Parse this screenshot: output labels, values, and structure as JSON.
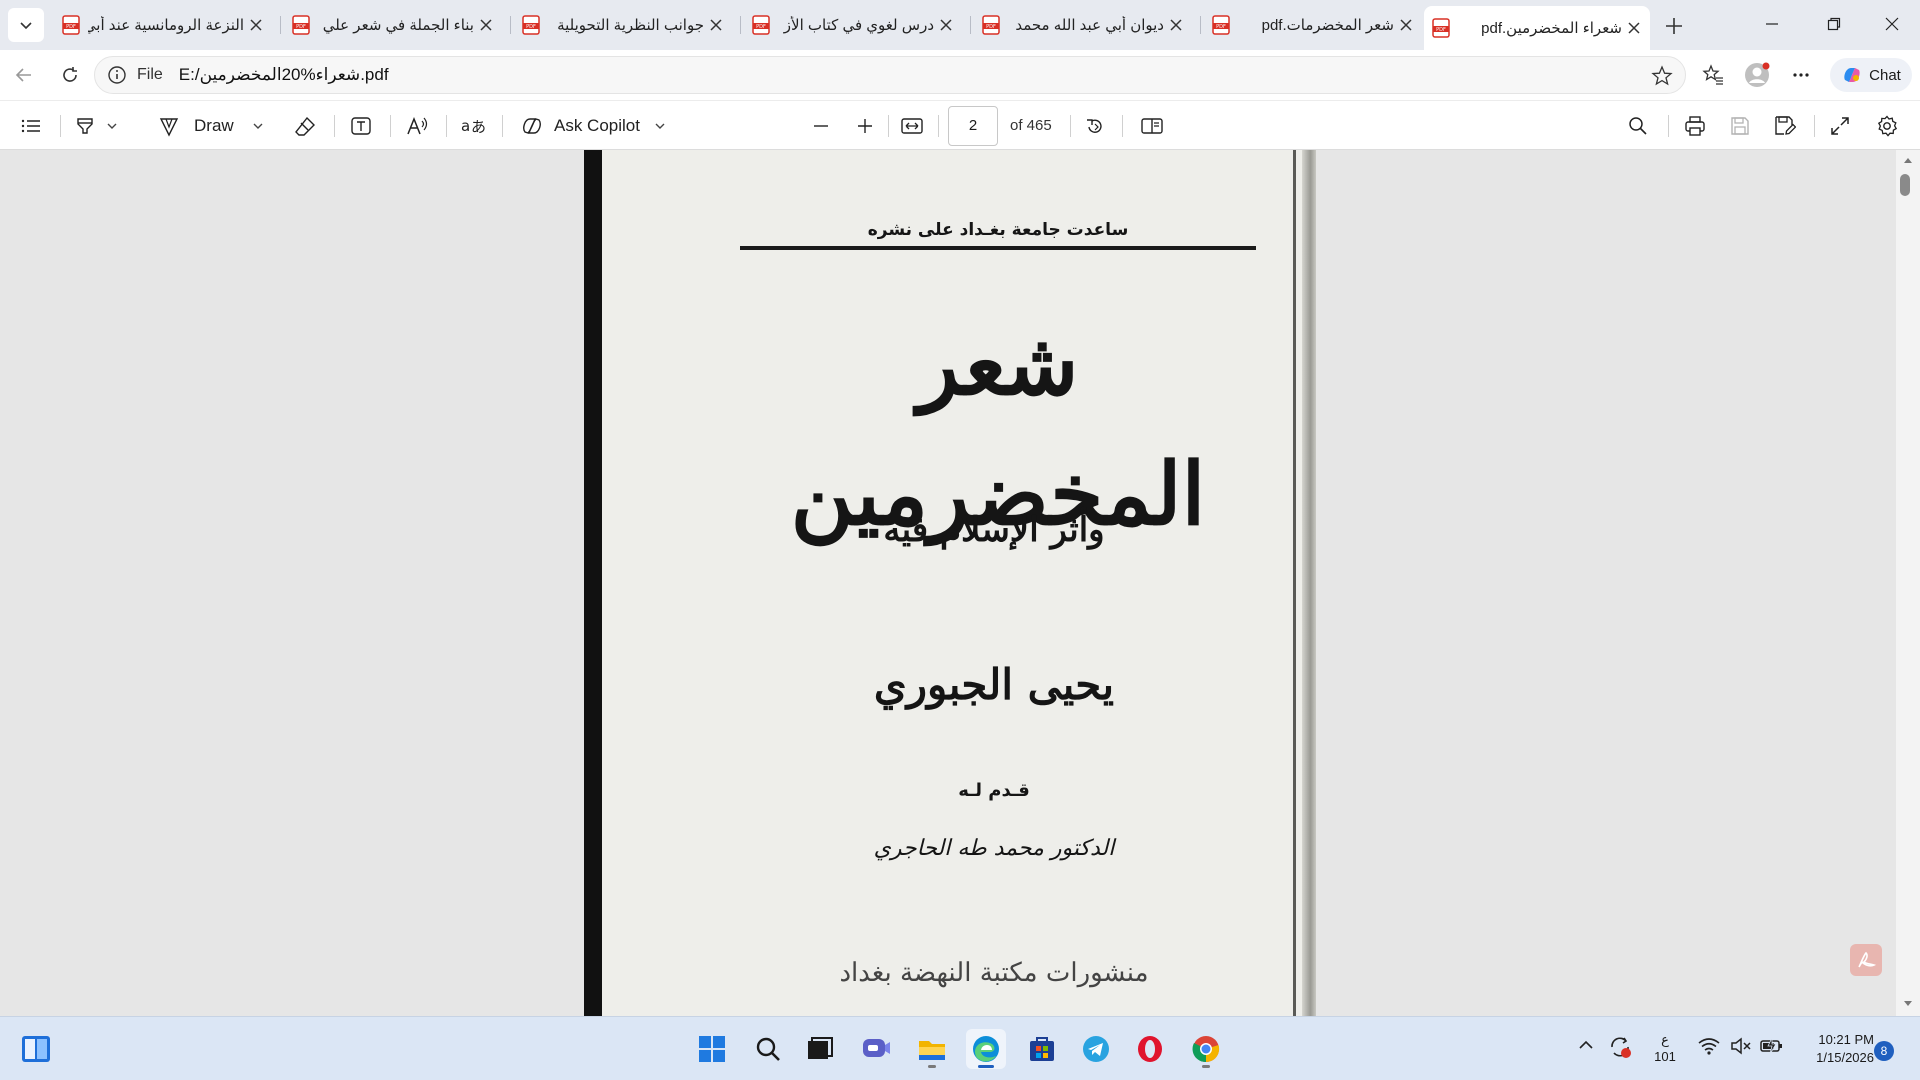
{
  "tabs": [
    {
      "title": "النزعة الرومانسية عند أبي",
      "active": false
    },
    {
      "title": "بناء الجملة في شعر علي",
      "active": false
    },
    {
      "title": "جوانب النظرية التحويلية",
      "active": false
    },
    {
      "title": "درس لغوي في كتاب الأز",
      "active": false
    },
    {
      "title": "ديوان أبي عبد الله محمد",
      "active": false
    },
    {
      "title": "شعر المخضرمات.pdf",
      "active": false
    },
    {
      "title": "شعراء المخضرمين.pdf",
      "active": true
    }
  ],
  "address": {
    "scheme_label": "File",
    "url": "E:/شعراء%20المخضرمين.pdf"
  },
  "chat_label": "Chat",
  "pdf_toolbar": {
    "draw_label": "Draw",
    "copilot_label": "Ask Copilot",
    "page_number": "2",
    "page_total": "of 465"
  },
  "document": {
    "header": "ساعدت جامعة بغـداد على نشره",
    "title": "شعر المخضرمين",
    "subtitle": "وأثر الإسلام فيه",
    "author": "يحيى الجبوري",
    "intro_label": "قـدم لـه",
    "presenter": "الدكتور محمد طه الحاجري",
    "publisher": "منشورات مكتبة النهضة بغداد"
  },
  "taskbar": {
    "apps": [
      "start-icon",
      "search-icon",
      "task-view-icon",
      "teams-icon",
      "file-explorer-icon",
      "edge-icon",
      "store-icon",
      "telegram-icon",
      "opera-icon",
      "chrome-icon"
    ],
    "lang_top": "ع",
    "lang_bottom": "101",
    "time": "10:21 PM",
    "date": "1/15/2026",
    "notifications": "8"
  },
  "colors": {
    "tabstrip": "#e7eaf0",
    "pdf_red": "#d93025",
    "accent": "#1f5fbf",
    "taskbar": "#dbe6f5"
  }
}
